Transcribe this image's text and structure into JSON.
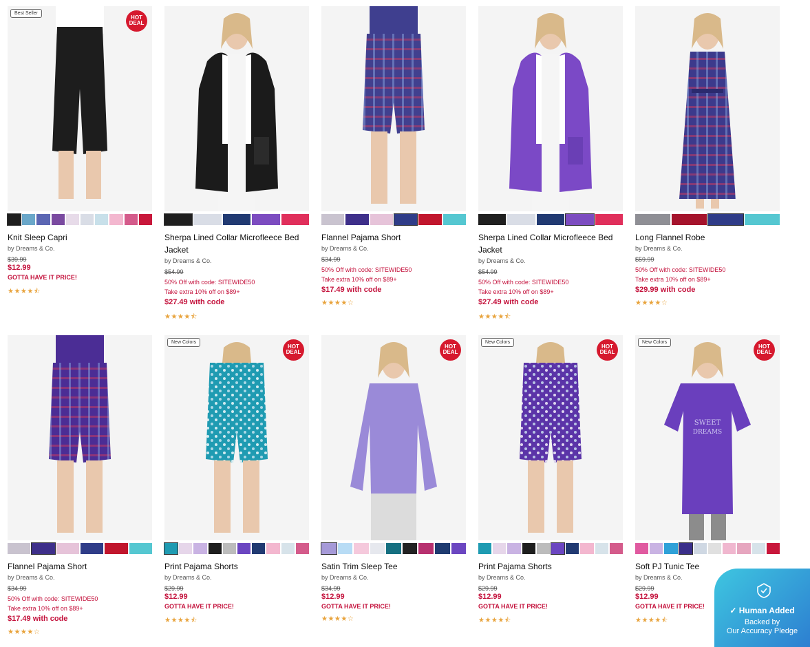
{
  "products": [
    {
      "name": "Knit Sleep Capri",
      "brand": "by Dreams & Co.",
      "was": "$39.99",
      "sale": "$12.99",
      "promo1": "",
      "promo2": "",
      "code_price": "",
      "gotta": "GOTTA HAVE IT PRICE!",
      "stars": "★★★★⯪",
      "badge": "Best Seller",
      "hot": "HOT DEAL",
      "img": {
        "bg": "#f4f4f4",
        "skin": "#e9c8ad",
        "top": "#ffffff",
        "bottom": "#1d1d1d",
        "pattern": "none",
        "style": "capri"
      },
      "swatches": [
        "#1e1e1e",
        "#6aa7c9",
        "#5b66b3",
        "#7a4aa0",
        "#e7dbe9",
        "#d9dde6",
        "#c8e0ea",
        "#f3b7cf",
        "#d45b8b",
        "#c8173b"
      ],
      "selected": 0
    },
    {
      "name": "Sherpa Lined Collar Microfleece Bed Jacket",
      "brand": "by Dreams & Co.",
      "was": "$54.99",
      "sale": "",
      "promo1": "50% Off with code: SITEWIDE50",
      "promo2": "Take extra 10% off on $89+",
      "code_price": "$27.49 with code",
      "gotta": "",
      "stars": "★★★★⯪",
      "badge": "",
      "hot": "",
      "img": {
        "bg": "#f4f4f4",
        "skin": "#e9c8ad",
        "top": "#1b1b1b",
        "bottom": "#d9d9d9",
        "pattern": "none",
        "style": "jacket"
      },
      "swatches": [
        "#1f1f1f",
        "#d9dde6",
        "#213a72",
        "#7c4cc0",
        "#e02f5b"
      ],
      "selected": 0
    },
    {
      "name": "Flannel Pajama Short",
      "brand": "by Dreams & Co.",
      "was": "$34.99",
      "sale": "",
      "promo1": "50% Off with code: SITEWIDE50",
      "promo2": "Take extra 10% off on $89+",
      "code_price": "$17.49 with code",
      "gotta": "",
      "stars": "★★★★☆",
      "badge": "",
      "hot": "",
      "img": {
        "bg": "#f4f4f4",
        "skin": "#e9c8ad",
        "top": "#3f3f8f",
        "bottom": "#41408f",
        "pattern": "plaid",
        "style": "shorts"
      },
      "swatches": [
        "#c9c3cf",
        "#3e2f8a",
        "#e6c3d9",
        "#2f3c88",
        "#c1162d",
        "#55c7d1"
      ],
      "selected": 3
    },
    {
      "name": "Sherpa Lined Collar Microfleece Bed Jacket",
      "brand": "by Dreams & Co.",
      "was": "$54.99",
      "sale": "",
      "promo1": "50% Off with code: SITEWIDE50",
      "promo2": "Take extra 10% off on $89+",
      "code_price": "$27.49 with code",
      "gotta": "",
      "stars": "★★★★⯪",
      "badge": "",
      "hot": "",
      "img": {
        "bg": "#f4f4f4",
        "skin": "#e9c8ad",
        "top": "#7b49c6",
        "bottom": "#d9d9d9",
        "pattern": "none",
        "style": "jacket"
      },
      "swatches": [
        "#1f1f1f",
        "#d9dde6",
        "#213a72",
        "#7c4cc0",
        "#e02f5b"
      ],
      "selected": 3
    },
    {
      "name": "Long Flannel Robe",
      "brand": "by Dreams & Co.",
      "was": "$59.99",
      "sale": "",
      "promo1": "50% Off with code: SITEWIDE50",
      "promo2": "Take extra 10% off on $89+",
      "code_price": "$29.99 with code",
      "gotta": "",
      "stars": "★★★★☆",
      "badge": "",
      "hot": "",
      "img": {
        "bg": "#f4f4f4",
        "skin": "#e9c8ad",
        "top": "#3c3a8c",
        "bottom": "#3c3a8c",
        "pattern": "plaid",
        "style": "robe"
      },
      "swatches": [
        "#8f8f95",
        "#a5132c",
        "#2f3c88",
        "#55c7d1"
      ],
      "selected": 2
    },
    {
      "name": "Flannel Pajama Short",
      "brand": "by Dreams & Co.",
      "was": "$34.99",
      "sale": "",
      "promo1": "50% Off with code: SITEWIDE50",
      "promo2": "Take extra 10% off on $89+",
      "code_price": "$17.49 with code",
      "gotta": "",
      "stars": "★★★★☆",
      "badge": "",
      "hot": "",
      "img": {
        "bg": "#f4f4f4",
        "skin": "#e9c8ad",
        "top": "#4b2d95",
        "bottom": "#4b2d95",
        "pattern": "plaid",
        "style": "shorts"
      },
      "swatches": [
        "#c9c3cf",
        "#3e2f8a",
        "#e6c3d9",
        "#2f3c88",
        "#c1162d",
        "#55c7d1"
      ],
      "selected": 1
    },
    {
      "name": "Print Pajama Shorts",
      "brand": "by Dreams & Co.",
      "was": "$29.99",
      "sale": "$12.99",
      "promo1": "",
      "promo2": "",
      "code_price": "",
      "gotta": "GOTTA HAVE IT PRICE!",
      "stars": "★★★★⯪",
      "badge": "New Colors",
      "hot": "HOT DEAL",
      "img": {
        "bg": "#f4f4f4",
        "skin": "#e9c8ad",
        "top": "#ffffff",
        "bottom": "#1f9bb2",
        "pattern": "print",
        "style": "shorts"
      },
      "swatches": [
        "#1f9bb2",
        "#e6d6ea",
        "#c9b3e3",
        "#1e1e1e",
        "#bcbcbc",
        "#6b46c1",
        "#213a72",
        "#f3b7cf",
        "#d7e3ea",
        "#d45b8b"
      ],
      "selected": 0
    },
    {
      "name": "Satin Trim Sleep Tee",
      "brand": "by Dreams & Co.",
      "was": "$34.99",
      "sale": "$12.99",
      "promo1": "",
      "promo2": "",
      "code_price": "",
      "gotta": "GOTTA HAVE IT PRICE!",
      "stars": "★★★★☆",
      "badge": "",
      "hot": "HOT DEAL",
      "img": {
        "bg": "#f4f4f4",
        "skin": "#e9c8ad",
        "top": "#9a8ad8",
        "bottom": "#dcdcdc",
        "pattern": "none",
        "style": "tee"
      },
      "swatches": [
        "#a69ad8",
        "#b8dcf5",
        "#f5c9dc",
        "#e6e8ee",
        "#156f80",
        "#222222",
        "#b7316f",
        "#1f3b70",
        "#6b46c1"
      ],
      "selected": 0
    },
    {
      "name": "Print Pajama Shorts",
      "brand": "by Dreams & Co.",
      "was": "$29.99",
      "sale": "$12.99",
      "promo1": "",
      "promo2": "",
      "code_price": "",
      "gotta": "GOTTA HAVE IT PRICE!",
      "stars": "★★★★⯪",
      "badge": "New Colors",
      "hot": "HOT DEAL",
      "img": {
        "bg": "#f4f4f4",
        "skin": "#e9c8ad",
        "top": "#ffffff",
        "bottom": "#5b34a8",
        "pattern": "print",
        "style": "shorts"
      },
      "swatches": [
        "#1f9bb2",
        "#e6d6ea",
        "#c9b3e3",
        "#1e1e1e",
        "#bcbcbc",
        "#6b46c1",
        "#213a72",
        "#f3b7cf",
        "#d7e3ea",
        "#d45b8b"
      ],
      "selected": 5
    },
    {
      "name": "Soft PJ Tunic Tee",
      "brand": "by Dreams & Co.",
      "was": "$29.99",
      "sale": "$12.99",
      "promo1": "",
      "promo2": "",
      "code_price": "",
      "gotta": "GOTTA HAVE IT PRICE!",
      "stars": "★★★★⯪",
      "badge": "New Colors",
      "hot": "HOT DEAL",
      "img": {
        "bg": "#f4f4f4",
        "skin": "#e9c8ad",
        "top": "#6a3fbd",
        "bottom": "#8c8c8c",
        "pattern": "none",
        "style": "tunic"
      },
      "swatches": [
        "#e05aa0",
        "#c9b3e3",
        "#2fa1d8",
        "#3a2f8a",
        "#cfd8e3",
        "#e0e0e0",
        "#f0b7cf",
        "#e6a6bf",
        "#d7e3ea",
        "#c8173b"
      ],
      "selected": 3
    }
  ],
  "pledge": {
    "title": "Human Added",
    "line1": "Backed by",
    "line2": "Our Accuracy Pledge"
  }
}
